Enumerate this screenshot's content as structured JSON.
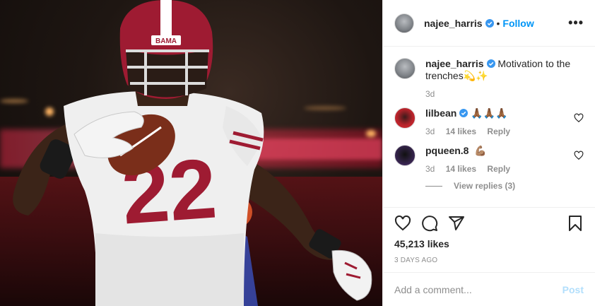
{
  "post": {
    "username": "najee_harris",
    "follow_label": "Follow",
    "dot": "•",
    "more_label": "•••",
    "caption": {
      "username": "najee_harris",
      "text": "Motivation to the trenches💫✨",
      "time": "3d"
    },
    "comments": [
      {
        "username": "lilbean",
        "text": "🙏🏾🙏🏾🙏🏾",
        "time": "3d",
        "likes": "14 likes",
        "reply_label": "Reply"
      },
      {
        "username": "pqueen.8",
        "text": "💪🏽",
        "time": "3d",
        "likes": "14 likes",
        "reply_label": "Reply"
      }
    ],
    "view_replies": "View replies (3)",
    "likes_count": "45,213 likes",
    "date_label": "3 DAYS AGO",
    "add_comment_placeholder": "Add a comment...",
    "post_label": "Post"
  },
  "photo": {
    "jersey_number": "22",
    "helmet_text": "BAMA"
  },
  "colors": {
    "accent": "#0095f6",
    "post_disabled": "#b2dffc",
    "muted": "#8e8e8e",
    "helmet": "#9e1b32"
  }
}
